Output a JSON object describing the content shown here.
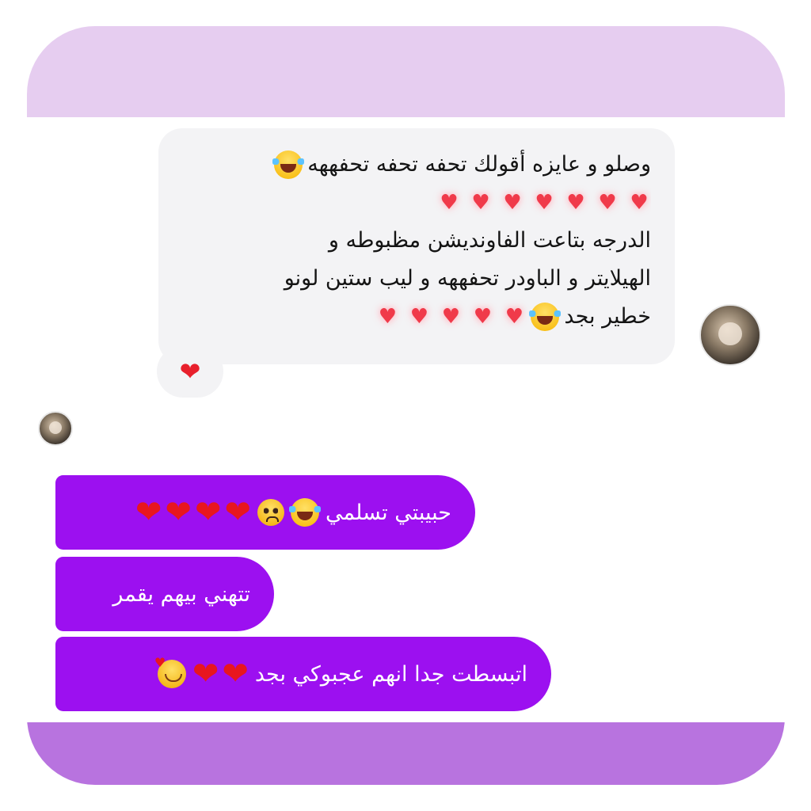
{
  "received": {
    "lines": [
      "وصلو و عايزه أقولك تحفه تحفه تحفههه",
      "",
      "الدرجه بتاعت الفاونديشن مظبوطه و",
      "الهيلايتر و الباودر تحفههه و ليب ستين لونو",
      "خطير بجد"
    ],
    "line1_emoji": "laugh-cry-emoji",
    "line2_hearts": [
      "♥",
      "♥",
      "♥",
      "♥",
      "♥",
      "♥",
      "♥"
    ],
    "line5_hearts": [
      "♥",
      "♥",
      "♥",
      "♥",
      "♥"
    ],
    "reaction": "❤"
  },
  "sent": [
    {
      "text": "حبيبتي تسلمي",
      "hearts": [
        "❤",
        "❤",
        "❤",
        "❤"
      ]
    },
    {
      "text": "تتهني بيهم يقمر",
      "hearts": []
    },
    {
      "text": "اتبسطت جدا انهم عجبوكي بجد",
      "hearts": [
        "❤",
        "❤"
      ]
    }
  ],
  "colors": {
    "top_band": "#e6cdf0",
    "bottom_band": "#b873df",
    "sent_bubble": "#9c10f0",
    "received_bubble": "#f3f3f5"
  }
}
